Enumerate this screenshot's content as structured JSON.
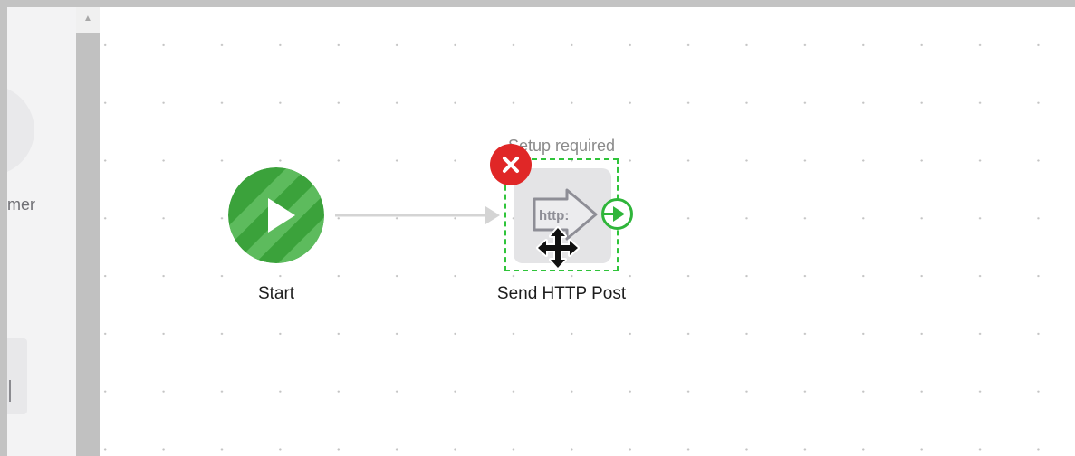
{
  "canvas": {
    "nodes": {
      "start": {
        "label": "Start",
        "icon": "play-icon",
        "color": "#3eaa3e"
      },
      "http_post": {
        "label": "Send HTTP Post",
        "status": "Setup required",
        "icon_text": "http:",
        "icon": "http-arrow-icon",
        "error_icon": "close-icon",
        "selection_color": "#2fc43a",
        "error_color": "#e02727"
      }
    },
    "connector": {
      "from": "Start",
      "to": "Send HTTP Post"
    }
  },
  "palette": {
    "partial_label": "mer"
  },
  "scrollbar": {
    "up_icon": "▲"
  }
}
